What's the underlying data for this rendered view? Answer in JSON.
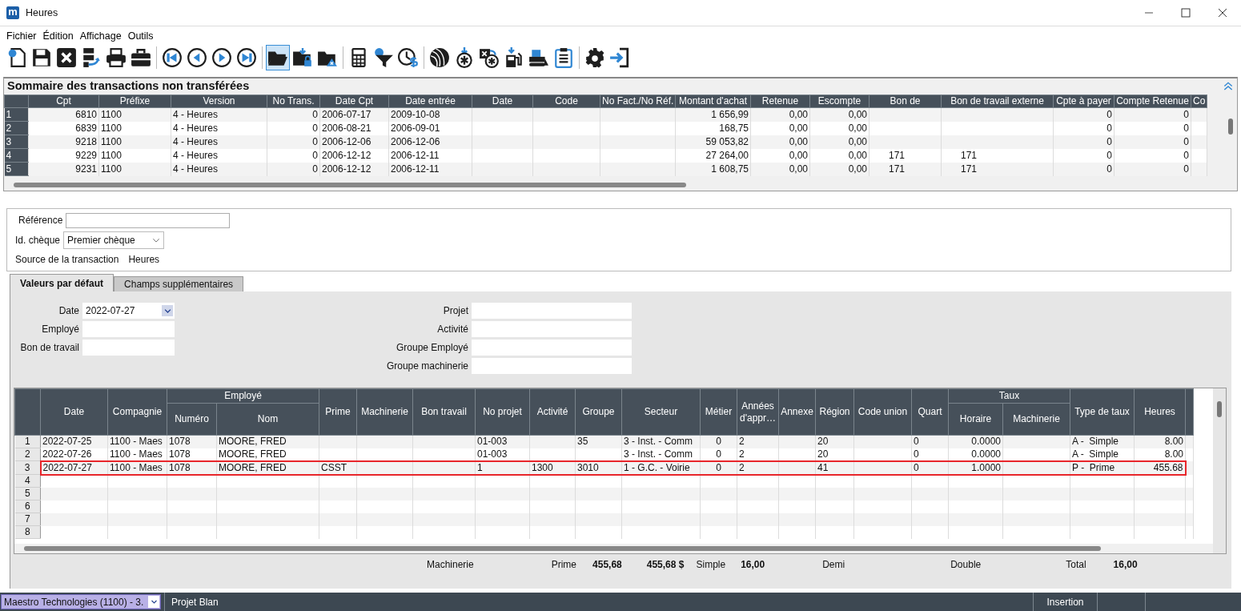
{
  "window": {
    "logo": "m",
    "title": "Heures"
  },
  "menu": [
    {
      "label": "Fichier"
    },
    {
      "label": "Édition"
    },
    {
      "label": "Affichage"
    },
    {
      "label": "Outils"
    }
  ],
  "toolbar": [
    {
      "selected": false
    },
    {
      "selected": false
    },
    {
      "selected": false
    },
    {
      "selected": false
    },
    {
      "selected": false
    },
    {
      "selected": false
    },
    {
      "selected": false
    },
    {
      "selected": false
    },
    {
      "selected": false
    },
    {
      "selected": false
    },
    {
      "selected": true
    },
    {
      "selected": false
    },
    {
      "selected": false
    },
    {
      "selected": false
    },
    {
      "selected": false
    },
    {
      "selected": false
    },
    {
      "selected": false
    },
    {
      "selected": false
    },
    {
      "selected": false
    },
    {
      "selected": false
    },
    {
      "selected": false
    },
    {
      "selected": false
    },
    {
      "selected": false
    },
    {
      "selected": false
    }
  ],
  "summary": {
    "title": "Sommaire des transactions non transférées",
    "columns": [
      "Cpt",
      "Préfixe",
      "Version",
      "No Trans.",
      "Date Cpt",
      "Date entrée",
      "Date",
      "Code",
      "No Fact./No Réf.",
      "Montant d'achat",
      "Retenue",
      "Escompte",
      "Bon de",
      "Bon de travail externe",
      "Cpte à payer",
      "Compte Retenue",
      "Co"
    ],
    "rows": [
      {
        "number": "1",
        "cells": [
          "6810",
          "1100",
          "4 - Heures",
          "0",
          "2006-07-17",
          "2009-10-08",
          "",
          "",
          "",
          "1 656,99",
          "0,00",
          "0,00",
          "",
          "",
          "0",
          "0",
          ""
        ]
      },
      {
        "number": "2",
        "cells": [
          "6839",
          "1100",
          "4 - Heures",
          "0",
          "2006-08-21",
          "2006-09-01",
          "",
          "",
          "",
          "168,75",
          "0,00",
          "0,00",
          "",
          "",
          "0",
          "0",
          ""
        ]
      },
      {
        "number": "3",
        "cells": [
          "9218",
          "1100",
          "4 - Heures",
          "0",
          "2006-12-06",
          "2006-12-06",
          "",
          "",
          "",
          "59 053,82",
          "0,00",
          "0,00",
          "",
          "",
          "0",
          "0",
          ""
        ]
      },
      {
        "number": "4",
        "cells": [
          "9229",
          "1100",
          "4 - Heures",
          "0",
          "2006-12-12",
          "2006-12-11",
          "",
          "",
          "",
          "27 264,00",
          "0,00",
          "0,00",
          "171",
          "171",
          "0",
          "0",
          ""
        ]
      },
      {
        "number": "5",
        "cells": [
          "9231",
          "1100",
          "4 - Heures",
          "0",
          "2006-12-12",
          "2006-12-11",
          "",
          "",
          "",
          "1 608,75",
          "0,00",
          "0,00",
          "171",
          "171",
          "0",
          "0",
          ""
        ]
      }
    ]
  },
  "header_form": {
    "reference": {
      "label": "Référence"
    },
    "cheque": {
      "label": "Id. chèque",
      "value": "Premier chèque"
    },
    "source": {
      "label": "Source de la transaction",
      "value": "Heures"
    }
  },
  "tabs": [
    {
      "label": "Valeurs par défaut",
      "selected": true
    },
    {
      "label": "Champs supplémentaires",
      "selected": false
    }
  ],
  "defaults": {
    "left": [
      {
        "label": "Date",
        "value": "2022-07-27",
        "kind": "date"
      },
      {
        "label": "Employé",
        "kind": "text"
      },
      {
        "label": "Bon de travail",
        "kind": "text"
      }
    ],
    "right": [
      {
        "label": "Projet",
        "kind": "text"
      },
      {
        "label": "Activité",
        "kind": "text"
      },
      {
        "label": "Groupe Employé",
        "kind": "text"
      },
      {
        "label": "Groupe machinerie",
        "kind": "text"
      }
    ]
  },
  "grid": {
    "header": [
      {
        "kind": "column",
        "label": "Date"
      },
      {
        "kind": "column",
        "label": "Compagnie"
      },
      {
        "kind": "group",
        "label": "Employé",
        "columns": [
          "Numéro",
          "Nom"
        ]
      },
      {
        "kind": "column",
        "label": "Prime"
      },
      {
        "kind": "column",
        "label": "Machinerie"
      },
      {
        "kind": "column",
        "label": "Bon travail"
      },
      {
        "kind": "column",
        "label": "No projet"
      },
      {
        "kind": "column",
        "label": "Activité"
      },
      {
        "kind": "column",
        "label": "Groupe"
      },
      {
        "kind": "column",
        "label": "Secteur"
      },
      {
        "kind": "column",
        "label": "Métier"
      },
      {
        "kind": "column",
        "label": "Années d'appr…"
      },
      {
        "kind": "column",
        "label": "Annexe"
      },
      {
        "kind": "column",
        "label": "Région"
      },
      {
        "kind": "column",
        "label": "Code union"
      },
      {
        "kind": "column",
        "label": "Quart"
      },
      {
        "kind": "group",
        "label": "Taux",
        "columns": [
          "Horaire",
          "Machinerie"
        ]
      },
      {
        "kind": "column",
        "label": "Type de taux"
      },
      {
        "kind": "column",
        "label": "Heures"
      }
    ],
    "rows": [
      {
        "number": "1",
        "selected": false,
        "cells": [
          "2022-07-25",
          "1100 - Maes",
          "1078",
          "MOORE, FRED",
          "",
          "",
          "",
          "01-003",
          "",
          "35",
          "3 - Inst. - Comm",
          "0",
          "2",
          "",
          "20",
          "",
          "0",
          "0.0000",
          "",
          "A -  Simple",
          "8.00"
        ]
      },
      {
        "number": "2",
        "selected": false,
        "cells": [
          "2022-07-26",
          "1100 - Maes",
          "1078",
          "MOORE, FRED",
          "",
          "",
          "",
          "01-003",
          "",
          "",
          "3 - Inst. - Comm",
          "0",
          "2",
          "",
          "20",
          "",
          "0",
          "0.0000",
          "",
          "A -  Simple",
          "8.00"
        ]
      },
      {
        "number": "3",
        "selected": true,
        "cells": [
          "2022-07-27",
          "1100 - Maes",
          "1078",
          "MOORE, FRED",
          "CSST",
          "",
          "",
          "1",
          "1300",
          "3010",
          "1 - G.C. - Voirie",
          "0",
          "2",
          "",
          "41",
          "",
          "0",
          "1.0000",
          "",
          "P -  Prime",
          "455.68"
        ]
      },
      {
        "number": "4",
        "selected": false
      },
      {
        "number": "5",
        "selected": false
      },
      {
        "number": "6",
        "selected": false
      },
      {
        "number": "7",
        "selected": false
      },
      {
        "number": "8",
        "selected": false
      }
    ]
  },
  "totals": [
    {
      "kind": "label",
      "text": "Machinerie"
    },
    {
      "kind": "label",
      "text": "Prime"
    },
    {
      "kind": "value",
      "text": "455,68"
    },
    {
      "kind": "value",
      "text": "455,68 $"
    },
    {
      "kind": "label",
      "text": "Simple"
    },
    {
      "kind": "value",
      "text": "16,00"
    },
    {
      "kind": "label",
      "text": "Demi"
    },
    {
      "kind": "label",
      "text": "Double"
    },
    {
      "kind": "label",
      "text": "Total"
    },
    {
      "kind": "value",
      "text": "16,00"
    }
  ],
  "status_bar": {
    "company": "Maestro Technologies (1100) - 3.",
    "project": "Projet Blan",
    "mode": "Insertion"
  }
}
